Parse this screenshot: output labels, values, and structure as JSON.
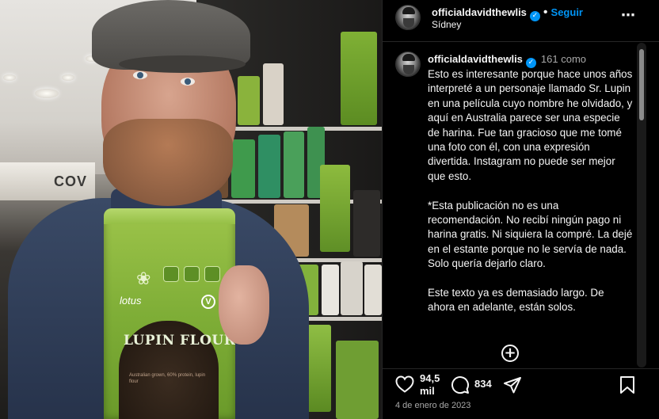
{
  "post": {
    "image_alt": "Man holding a bag of lupin flour in a store aisle",
    "product": {
      "brand": "lotus",
      "name": "LUPIN FLOUR",
      "badge": "V",
      "small_print": "Australian grown, 60% protein, lupin flour"
    },
    "store_sign": "COV"
  },
  "header": {
    "username": "officialdavidthewlis",
    "verified_mark": "✓",
    "separator": "•",
    "follow_label": "Seguir",
    "location": "Sídney",
    "more_label": "⋯"
  },
  "caption": {
    "username": "officialdavidthewlis",
    "verified_mark": "✓",
    "time_ago": "161 como",
    "paragraphs": [
      "Esto es interesante porque hace unos años interpreté a un personaje llamado Sr. Lupin en una película cuyo nombre he olvidado, y aquí en Australia parece ser una especie de harina. Fue tan gracioso que me tomé una foto con él, con una expresión divertida. Instagram no puede ser mejor que esto.",
      "*Esta publicación no es una recomendación. No recibí ningún pago ni harina gratis. Ni siquiera la compré. La dejé en el estante porque no le servía de nada. Solo quería dejarlo claro.",
      "Este texto ya es demasiado largo. De ahora en adelante, están solos."
    ],
    "load_more_label": "+"
  },
  "actions": {
    "likes_line1": "94,5",
    "likes_line2": "mil",
    "comments_count": "834",
    "date": "4 de enero de 2023"
  },
  "colors": {
    "accent": "#0095f6",
    "text": "#f5f5f5",
    "muted": "#a8a8a8",
    "background": "#000000",
    "bag_green": "#7fae37"
  }
}
